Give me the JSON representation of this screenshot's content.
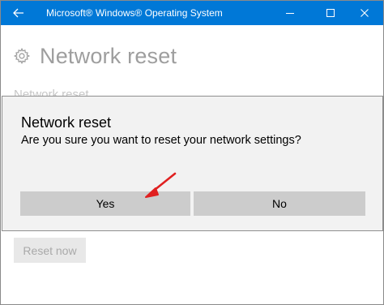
{
  "window": {
    "title": "Microsoft® Windows® Operating System",
    "back_icon": "back-arrow-icon",
    "minimize_icon": "minimize-icon",
    "maximize_icon": "maximize-icon",
    "close_icon": "close-icon",
    "titlebar_color": "#0078d7"
  },
  "page": {
    "title": "Network reset",
    "title_icon": "gear-icon",
    "subtitle_partial": "Network reset",
    "reset_button_label": "Reset now"
  },
  "dialog": {
    "title": "Network reset",
    "message": "Are you sure you want to reset your network settings?",
    "yes_label": "Yes",
    "no_label": "No"
  },
  "annotation": {
    "arrow_color": "#e02020"
  }
}
